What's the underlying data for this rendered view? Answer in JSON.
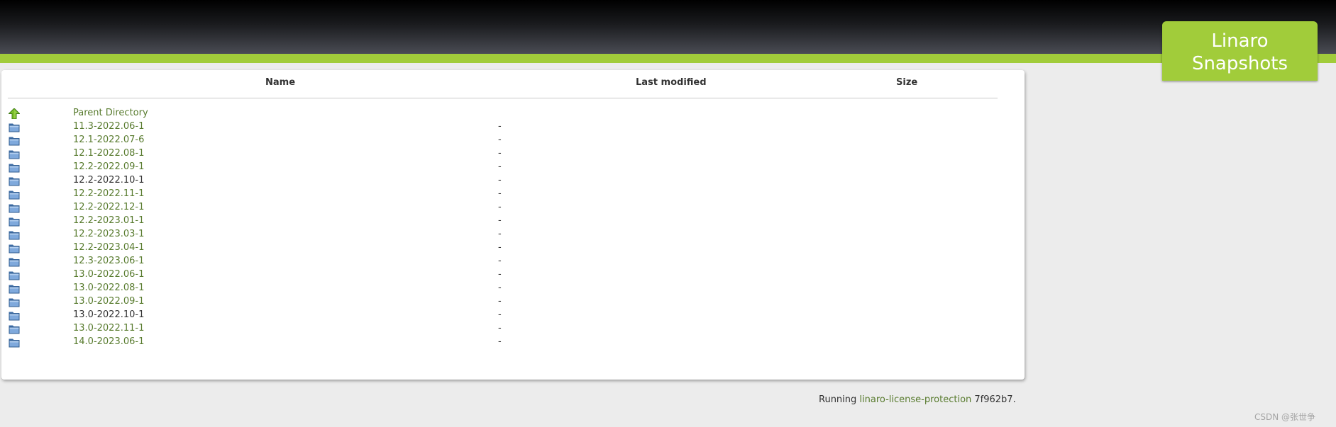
{
  "brand": {
    "line1": "Linaro",
    "line2": "Snapshots"
  },
  "table": {
    "headers": {
      "name": "Name",
      "last_modified": "Last modified",
      "size": "Size"
    },
    "parent": {
      "label": "Parent Directory",
      "icon": "up-arrow-icon"
    },
    "rows": [
      {
        "name": "11.3-2022.06-1",
        "modified": "-",
        "visited": false
      },
      {
        "name": "12.1-2022.07-6",
        "modified": "-",
        "visited": false
      },
      {
        "name": "12.1-2022.08-1",
        "modified": "-",
        "visited": false
      },
      {
        "name": "12.2-2022.09-1",
        "modified": "-",
        "visited": false
      },
      {
        "name": "12.2-2022.10-1",
        "modified": "-",
        "visited": true
      },
      {
        "name": "12.2-2022.11-1",
        "modified": "-",
        "visited": false
      },
      {
        "name": "12.2-2022.12-1",
        "modified": "-",
        "visited": false
      },
      {
        "name": "12.2-2023.01-1",
        "modified": "-",
        "visited": false
      },
      {
        "name": "12.2-2023.03-1",
        "modified": "-",
        "visited": false
      },
      {
        "name": "12.2-2023.04-1",
        "modified": "-",
        "visited": false
      },
      {
        "name": "12.3-2023.06-1",
        "modified": "-",
        "visited": false
      },
      {
        "name": "13.0-2022.06-1",
        "modified": "-",
        "visited": false
      },
      {
        "name": "13.0-2022.08-1",
        "modified": "-",
        "visited": false
      },
      {
        "name": "13.0-2022.09-1",
        "modified": "-",
        "visited": false
      },
      {
        "name": "13.0-2022.10-1",
        "modified": "-",
        "visited": true
      },
      {
        "name": "13.0-2022.11-1",
        "modified": "-",
        "visited": false
      },
      {
        "name": "14.0-2023.06-1",
        "modified": "-",
        "visited": false
      }
    ]
  },
  "footer": {
    "prefix": "Running ",
    "link": "linaro-license-protection",
    "suffix": " 7f962b7."
  },
  "watermark": "CSDN @张世争",
  "colors": {
    "accent_green": "#a1cc3a",
    "link_green": "#587b2e",
    "folder_blue": "#5b8fcf"
  }
}
